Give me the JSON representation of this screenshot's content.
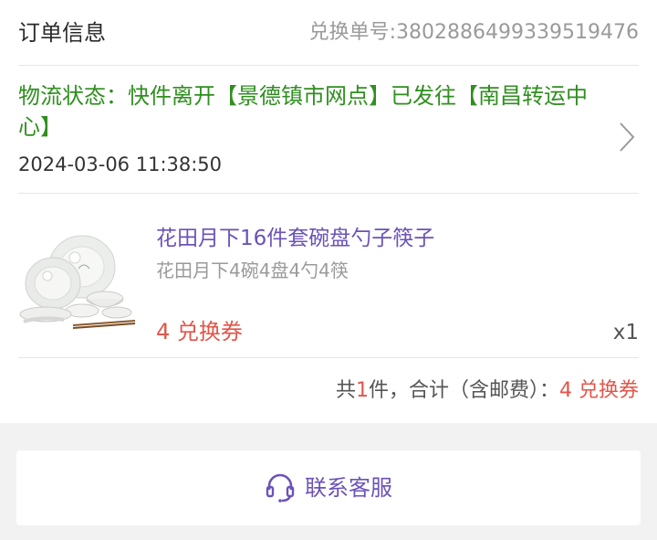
{
  "order": {
    "title": "订单信息",
    "exchange_no": "兑换单号:3802886499339519476"
  },
  "logistics": {
    "status": "物流状态：快件离开【景德镇市网点】已发往【南昌转运中心】",
    "time": "2024-03-06 11:38:50"
  },
  "product": {
    "image_icon": "tableware-set-image",
    "name": "花田月下16件套碗盘勺子筷子",
    "spec": "花田月下4碗4盘4勺4筷",
    "price": "4 兑换券",
    "qty": "x1"
  },
  "summary": {
    "prefix": "共",
    "count": "1",
    "suffix": "件，合计（含邮费）：",
    "amount": "4 兑换券"
  },
  "service": {
    "label": "联系客服",
    "icon": "headset-icon"
  },
  "colors": {
    "green_status": "#2f8f1f",
    "purple_accent": "#6b52b8",
    "red_price": "#e2554a"
  }
}
